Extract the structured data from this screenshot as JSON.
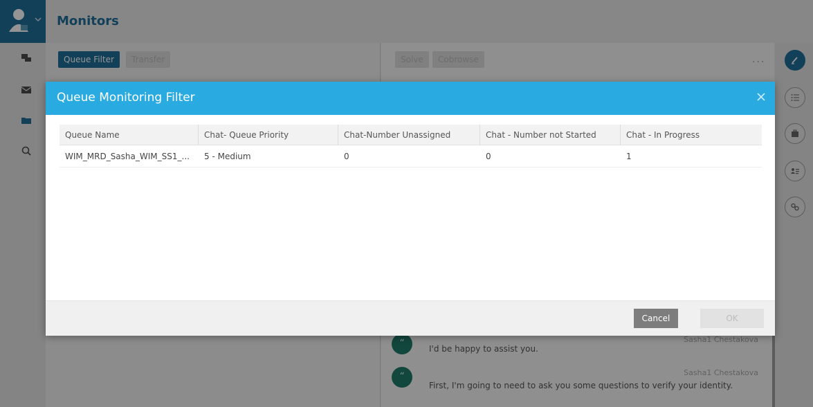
{
  "app": {
    "title": "Monitors"
  },
  "left_panel": {
    "tabs": [
      "Queue Filter",
      "Transfer"
    ]
  },
  "right_panel": {
    "actions": [
      "Solve",
      "Cobrowse"
    ],
    "more": "..."
  },
  "icons": {
    "avatar": "user-avatar-icon",
    "nav": [
      "chat-icon",
      "email-icon",
      "folder-icon",
      "search-icon"
    ],
    "rightbar": [
      "edit-icon",
      "list-icon",
      "briefcase-icon",
      "contact-card-icon",
      "link-icon"
    ]
  },
  "chat": {
    "messages": [
      {
        "sender": "Sasha1 Chestakova",
        "text": "I'd be happy to assist you."
      },
      {
        "sender": "Sasha1 Chestakova",
        "text": "First, I'm going to need to ask you some questions to verify your identity."
      }
    ]
  },
  "modal": {
    "title": "Queue Monitoring Filter",
    "columns": [
      "Queue Name",
      "Chat- Queue Priority",
      "Chat-Number Unassigned",
      "Chat - Number not Started",
      "Chat - In Progress"
    ],
    "rows": [
      [
        "WIM_MRD_Sasha_WIM_SS1_...",
        "5 - Medium",
        "0",
        "0",
        "1"
      ]
    ],
    "cancel_label": "Cancel",
    "ok_label": "OK"
  },
  "colors": {
    "accent": "#1f6f9a",
    "modal_header": "#29abe2",
    "chat_bubble": "#1f7a6a"
  }
}
